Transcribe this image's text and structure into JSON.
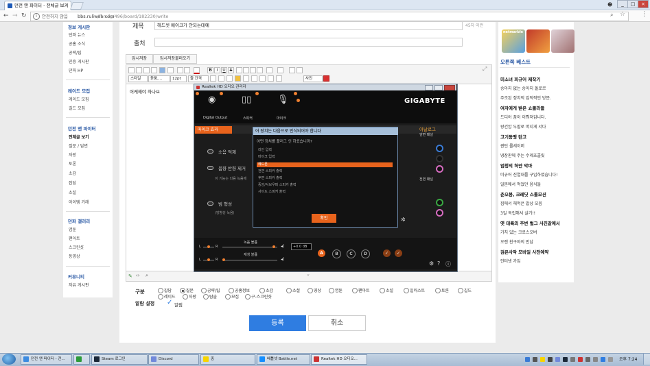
{
  "browser": {
    "tab_title": "던전 앤 파이터 - 전체글 보기",
    "tab_close": "×",
    "url_info": "i",
    "url_security": "안전하지 않음",
    "url_domain": "bbs.ruliweb.com",
    "url_path": "/family/496/board/182230/write",
    "window_buttons": [
      "_",
      "□",
      "×"
    ]
  },
  "left_sidebar": {
    "sections": [
      {
        "title": "정보 게시판",
        "items": [
          "던파 뉴스",
          "공홈 소식",
          "공략/팁",
          "인증 게시판",
          "던파 HP"
        ]
      },
      {
        "title": "레이드 모집",
        "items": [
          "레이드 모집",
          "길드 모집"
        ]
      },
      {
        "title": "던전 앤 파이터",
        "items": [
          "전체글 보기",
          "질문 / 답변",
          "자랑",
          "토론",
          "소감",
          "잡담",
          "소설",
          "아이템 거래"
        ],
        "active": "전체글 보기"
      },
      {
        "title": "던파 갤러리",
        "items": [
          "엽툰",
          "팬아트",
          "스크린샷",
          "동영상"
        ]
      },
      {
        "title": "커뮤니티",
        "items": [
          "자유 게시판"
        ]
      }
    ]
  },
  "form": {
    "title_label": "제목",
    "title_value": "헤드셋 메이크가 안되는데예",
    "title_count": "45자 이런",
    "source_label": "출처",
    "source_value": "",
    "tab_temp_save": "임시저장",
    "tab_temp_load": "임시저장불러오기",
    "toolbar_style": "스타일",
    "toolbar_font": "돋움,…",
    "toolbar_size": "12pt",
    "toolbar_spacing": "줄 간격",
    "toolbar_photo": "사진",
    "editor_content": "어케해야 하나요",
    "category_label": "구분",
    "categories": [
      "잡담",
      "질문",
      "공략/팁",
      "공홈정보",
      "소감",
      "소셜",
      "영상",
      "엽툰",
      "팬아트",
      "소설",
      "일러스트",
      "토론",
      "길드",
      "레이드",
      "자랑",
      "탐솔",
      "모집",
      "구-스크린샷"
    ],
    "selected_category": "질문",
    "notify_label": "알람 설정",
    "notify_value": "알림",
    "submit_label": "등록",
    "cancel_label": "취소"
  },
  "realtek": {
    "window_title": "Realtek HD 오디오 관리자",
    "devices": [
      "Digital Output",
      "스피커",
      "마이크"
    ],
    "brand": "GIGABYTE",
    "tab_mic_effect": "마이크 효과",
    "analog_label": "아날로그",
    "front_panel_1": "앞면 패널",
    "front_panel_2": "전면 패널",
    "option_noise": "소음 억제",
    "option_echo": "음향 반향 제거",
    "echo_note": "이 기능는 다음 녹음에",
    "option_beam": "빔 형성",
    "beam_note": "(방향성 녹음)",
    "record_volume": "녹음 볼륨",
    "playback_volume": "재생 볼륨",
    "gain_value": "+0.0 dB",
    "circle_labels": [
      "A",
      "B",
      "C",
      "D"
    ]
  },
  "dialog": {
    "title": "어 장치는 다음으로 인식되어야 합니다",
    "question": "어떤 장치를 플러그 인 하셨습니까?",
    "options": [
      "라인 입력",
      "마이크 입력",
      "헤드폰",
      "전면 스피커 출력",
      "후면 스피커 출력",
      "중앙/서브우퍼 스피커 출력",
      "사이드 스피커 출력"
    ],
    "selected": "헤드폰",
    "ok_label": "확인"
  },
  "right_sidebar": {
    "brand_tile": "netmarble",
    "best_title": "오른쪽 베스트",
    "entries": [
      {
        "text": "미소녀 피규어 제작기",
        "bold": true
      },
      {
        "text": "송아지 없는 송아지 돌로르",
        "bold": false
      },
      {
        "text": "주조된 정치적 업적적인 방문.",
        "bold": false
      },
      {
        "text": "여자에게 받은 쇼콜라들",
        "bold": true
      },
      {
        "text": "드디어 꿈이 이뤄져갑니다.",
        "bold": false
      },
      {
        "text": "왕건암 두팔로 떠지게 서다",
        "bold": false
      },
      {
        "text": "고기동맹 탄고",
        "bold": true
      },
      {
        "text": "퀸틴 롤세이버",
        "bold": false
      },
      {
        "text": "냉장판에 주는 수제초콜릿",
        "bold": false
      },
      {
        "text": "엄청의 하얀 악마",
        "bold": true
      },
      {
        "text": "미규어 진열대를 구입하였습니다!",
        "bold": false
      },
      {
        "text": "일본에서 먹었던 음식들",
        "bold": false
      },
      {
        "text": "춘오봉, 크레딧 스톨모션",
        "bold": true
      },
      {
        "text": "집에서 해먹은 밥상 모음",
        "bold": false
      },
      {
        "text": "3일 독립해서 살기!!",
        "bold": false
      },
      {
        "text": "옛 대륙의 주변 벌그 사진갈에서",
        "bold": true
      },
      {
        "text": "가치 있는 크로스오버",
        "bold": false
      },
      {
        "text": "오랜 친구와의 만남",
        "bold": false
      },
      {
        "text": "검은사막 모바일 사전예약",
        "bold": true
      },
      {
        "text": "인터넷 가입",
        "bold": false
      }
    ]
  },
  "taskbar": {
    "tasks": [
      "던전 앤 파이터 - 전...",
      "",
      "Steam 로그인",
      "Discord",
      "중",
      "배틀넷 Battle.net",
      "Realtek HD 오디오..."
    ],
    "clock": "오후 7:24"
  },
  "colors": {
    "accent_blue": "#2f7de1",
    "realtek_orange": "#e8631c",
    "sidebar_heading": "#2857a4"
  }
}
